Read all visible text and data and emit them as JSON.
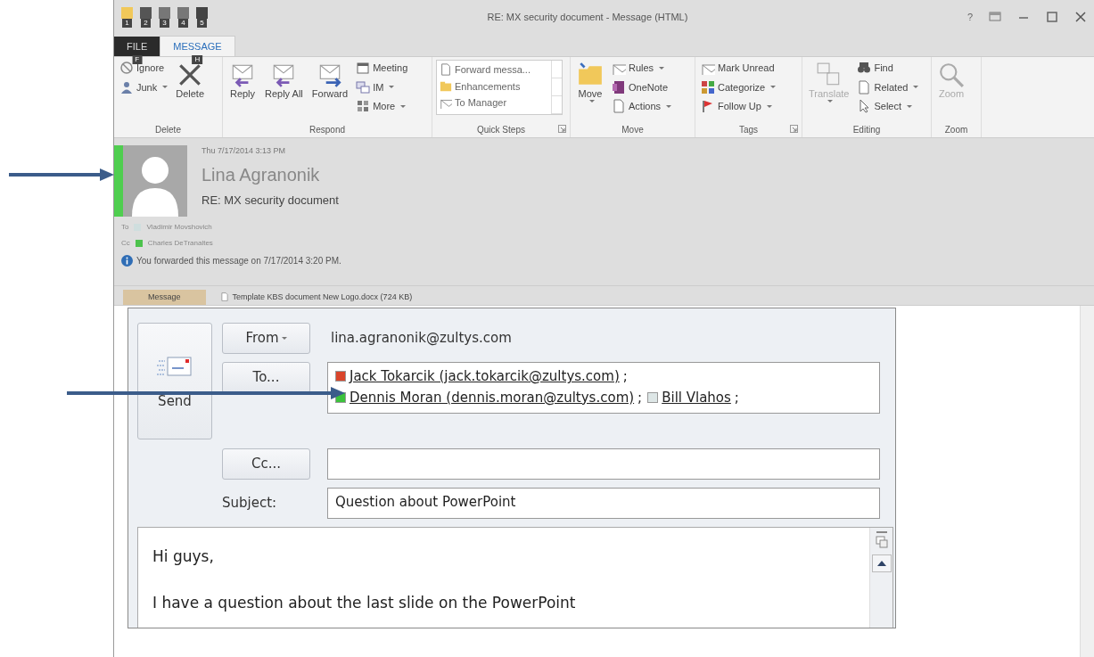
{
  "window": {
    "title": "RE: MX security document - Message (HTML)",
    "help": "?"
  },
  "quick_access": {
    "key_tips": [
      "1",
      "2",
      "3",
      "4",
      "5"
    ]
  },
  "ribbon_tabs": [
    {
      "label": "FILE",
      "key_tip": "F",
      "selected": false
    },
    {
      "label": "MESSAGE",
      "key_tip": "H",
      "selected": true
    }
  ],
  "ribbon_groups": [
    {
      "label": "Delete",
      "launcher": false,
      "columns": [
        {
          "kind": "stack",
          "items": [
            {
              "label": "Ignore",
              "dropdown": false,
              "disabled": false
            },
            {
              "label": "Junk",
              "dropdown": true,
              "disabled": false
            }
          ]
        },
        {
          "kind": "large",
          "label": "Delete",
          "dropdown": false,
          "disabled": false
        }
      ]
    },
    {
      "label": "Respond",
      "launcher": false,
      "columns": [
        {
          "kind": "large",
          "label": "Reply",
          "dropdown": false,
          "disabled": false
        },
        {
          "kind": "large",
          "label": "Reply All",
          "dropdown": false,
          "disabled": false
        },
        {
          "kind": "large",
          "label": "Forward",
          "dropdown": false,
          "disabled": false
        },
        {
          "kind": "stack",
          "items": [
            {
              "label": "Meeting",
              "dropdown": false,
              "disabled": false
            },
            {
              "label": "IM",
              "dropdown": true,
              "disabled": false
            },
            {
              "label": "More",
              "dropdown": true,
              "disabled": false
            }
          ]
        }
      ]
    },
    {
      "label": "Quick Steps",
      "launcher": true,
      "columns": [
        {
          "kind": "gallery",
          "items": [
            {
              "label": "Forward messa..."
            },
            {
              "label": "Enhancements"
            },
            {
              "label": "To Manager"
            }
          ]
        }
      ]
    },
    {
      "label": "Move",
      "launcher": false,
      "columns": [
        {
          "kind": "large",
          "label": "Move",
          "dropdown": true,
          "disabled": false
        },
        {
          "kind": "stack",
          "items": [
            {
              "label": "Rules",
              "dropdown": true,
              "disabled": false
            },
            {
              "label": "OneNote",
              "dropdown": false,
              "disabled": false
            },
            {
              "label": "Actions",
              "dropdown": true,
              "disabled": false
            }
          ]
        }
      ]
    },
    {
      "label": "Tags",
      "launcher": true,
      "columns": [
        {
          "kind": "stack",
          "items": [
            {
              "label": "Mark Unread",
              "dropdown": false,
              "disabled": false
            },
            {
              "label": "Categorize",
              "dropdown": true,
              "disabled": false
            },
            {
              "label": "Follow Up",
              "dropdown": true,
              "disabled": false
            }
          ]
        }
      ]
    },
    {
      "label": "Editing",
      "launcher": false,
      "columns": [
        {
          "kind": "large",
          "label": "Translate",
          "dropdown": true,
          "disabled": true
        },
        {
          "kind": "stack",
          "items": [
            {
              "label": "Find",
              "dropdown": false,
              "disabled": false
            },
            {
              "label": "Related",
              "dropdown": true,
              "disabled": false
            },
            {
              "label": "Select",
              "dropdown": true,
              "disabled": false
            }
          ]
        }
      ]
    },
    {
      "label": "Zoom",
      "launcher": false,
      "columns": [
        {
          "kind": "large",
          "label": "Zoom",
          "dropdown": false,
          "disabled": true
        }
      ]
    }
  ],
  "header": {
    "date": "Thu 7/17/2014 3:13 PM",
    "sender": "Lina Agranonik",
    "subject": "RE: MX security document",
    "to_label": "To",
    "to": [
      {
        "name": "Vladimir Movshovich",
        "color": "#cfdede"
      }
    ],
    "cc_label": "Cc",
    "cc": [
      {
        "name": "Charles DeTranaltes",
        "color": "#4cc24c"
      }
    ],
    "info": "You forwarded this message on 7/17/2014 3:20 PM."
  },
  "message_tabs": [
    {
      "label": "Message",
      "selected": true
    },
    {
      "label": "Template KBS document New Logo.docx (724 KB)",
      "selected": false
    }
  ],
  "compose": {
    "send": "Send",
    "from_button": "From",
    "from": "lina.agranonik@zultys.com",
    "to_button": "To...",
    "recipients": [
      {
        "name": "Jack Tokarcik (jack.tokarcik@zultys.com)",
        "separator": ";",
        "color": "#d9452b"
      },
      {
        "name": "Dennis Moran (dennis.moran@zultys.com)",
        "separator": ";",
        "color": "#3cc23c"
      },
      {
        "name": "Bill Vlahos",
        "separator": ";",
        "color": "#dde6e6"
      }
    ],
    "cc_button": "Cc...",
    "subject_label": "Subject:",
    "subject": "Question about PowerPoint",
    "body": [
      "Hi guys,",
      "I have a question about the last slide on the PowerPoint"
    ]
  }
}
